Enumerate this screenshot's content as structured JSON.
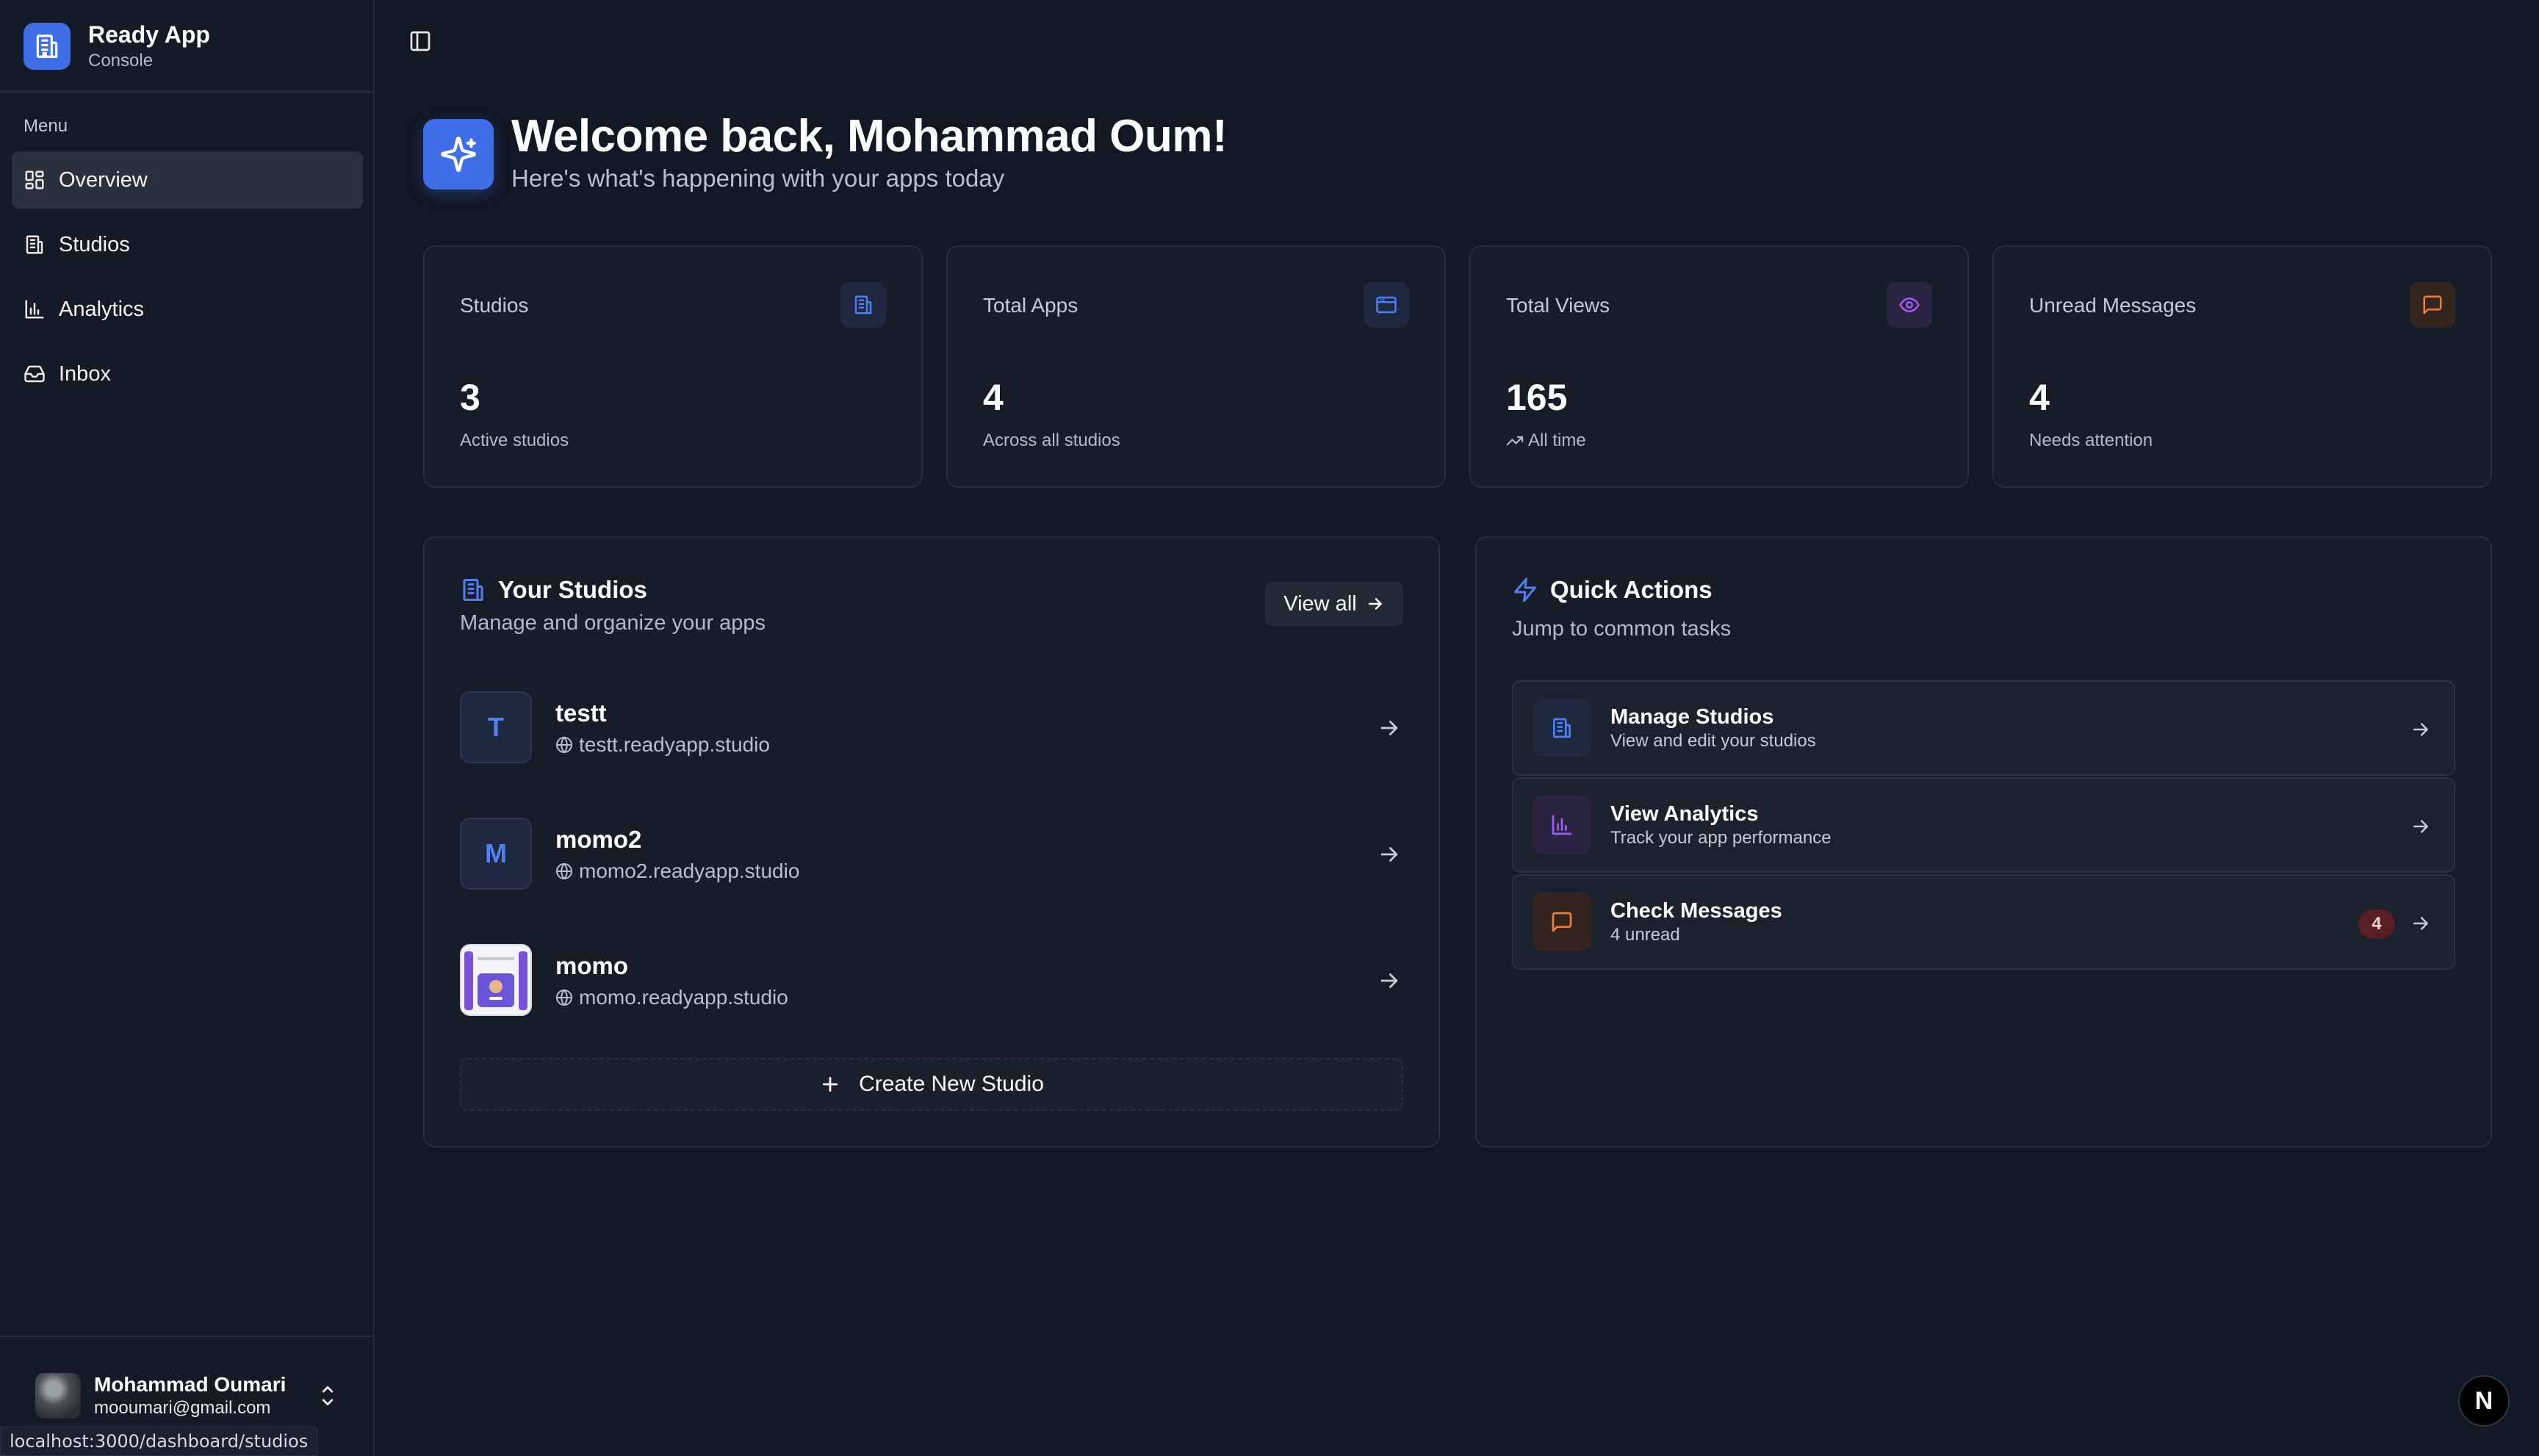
{
  "brand": {
    "title": "Ready App",
    "subtitle": "Console"
  },
  "sidebar": {
    "menu_label": "Menu",
    "items": [
      {
        "label": "Overview",
        "icon": "layout-grid-icon",
        "active": true
      },
      {
        "label": "Studios",
        "icon": "building-icon"
      },
      {
        "label": "Analytics",
        "icon": "bar-chart-icon"
      },
      {
        "label": "Inbox",
        "icon": "inbox-icon"
      }
    ]
  },
  "user": {
    "name": "Mohammad Oumari",
    "email": "mooumari@gmail.com"
  },
  "status_bar": {
    "url": "localhost:3000/dashboard/studios"
  },
  "hero": {
    "title": "Welcome back, Mohammad Oum!",
    "subtitle": "Here's what's happening with your apps today"
  },
  "stats": [
    {
      "title": "Studios",
      "value": "3",
      "caption": "Active studios",
      "icon": "building-icon",
      "color": "#4f80f0"
    },
    {
      "title": "Total Apps",
      "value": "4",
      "caption": "Across all studios",
      "icon": "app-window-icon",
      "color": "#4f80f0"
    },
    {
      "title": "Total Views",
      "value": "165",
      "caption": "All time",
      "icon": "eye-icon",
      "color": "#a25cf0"
    },
    {
      "title": "Unread Messages",
      "value": "4",
      "caption": "Needs attention",
      "icon": "message-square-icon",
      "color": "#e8823a"
    }
  ],
  "studios_panel": {
    "title": "Your Studios",
    "subtitle": "Manage and organize your apps",
    "view_all": "View all",
    "items": [
      {
        "initial": "T",
        "name": "testt",
        "domain": "testt.readyapp.studio"
      },
      {
        "initial": "M",
        "name": "momo2",
        "domain": "momo2.readyapp.studio"
      },
      {
        "initial": "",
        "name": "momo",
        "domain": "momo.readyapp.studio"
      }
    ],
    "create_label": "Create New Studio"
  },
  "quick_actions": {
    "title": "Quick Actions",
    "subtitle": "Jump to common tasks",
    "items": [
      {
        "title": "Manage Studios",
        "subtitle": "View and edit your studios",
        "icon": "building-icon",
        "color": "#4f80f0"
      },
      {
        "title": "View Analytics",
        "subtitle": "Track your app performance",
        "icon": "bar-chart-icon",
        "color": "#a25cf0"
      },
      {
        "title": "Check Messages",
        "subtitle": "4 unread",
        "icon": "message-square-icon",
        "color": "#e8823a",
        "badge": "4"
      }
    ]
  },
  "colors": {
    "accent": "#3f6ee8",
    "background": "#111723",
    "card": "#161d28"
  },
  "fab": {
    "label": "N"
  }
}
